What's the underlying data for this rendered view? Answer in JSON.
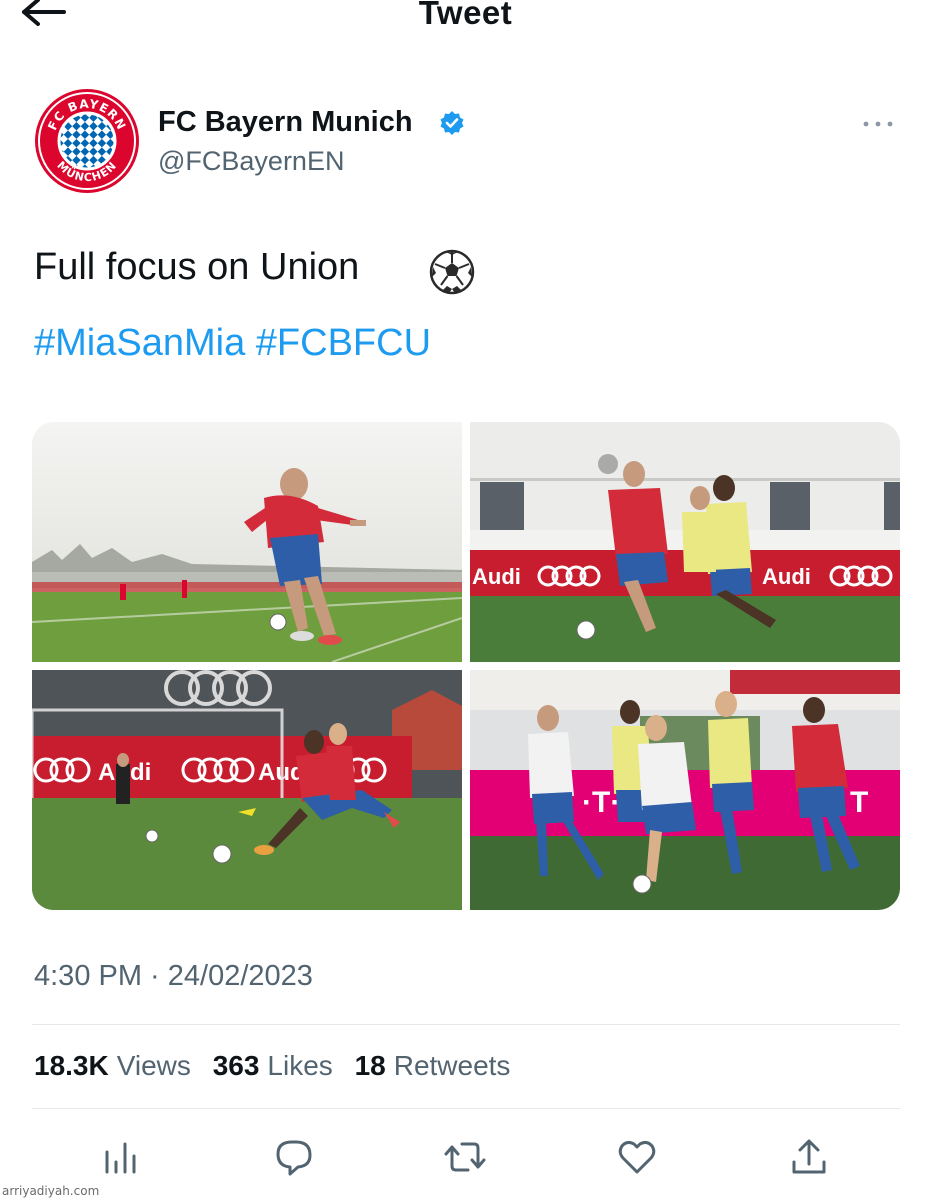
{
  "header": {
    "title": "Tweet",
    "back_icon": "arrow-left-icon"
  },
  "author": {
    "name": "FC Bayern Munich",
    "handle": "@FCBayernEN",
    "verified": true,
    "avatar_text_top": "FC BAYERN",
    "avatar_text_bottom": "MÜNCHEN",
    "colors": {
      "badge": "#1d9bf0",
      "brand_red": "#dc052d",
      "brand_blue": "#0066b2"
    }
  },
  "tweet": {
    "text": "Full focus on Union",
    "emoji": "soccer-ball-icon",
    "hashtags": [
      "#MiaSanMia",
      "#FCBFCU"
    ],
    "hashtag_color": "#1d9bf0"
  },
  "media": {
    "photo_count": 4,
    "board_text": "Audi"
  },
  "meta": {
    "timestamp": "4:30 PM · 24/02/2023"
  },
  "stats": {
    "views_count": "18.3K",
    "views_label": "Views",
    "likes_count": "363",
    "likes_label": "Likes",
    "retweets_count": "18",
    "retweets_label": "Retweets"
  },
  "actions": [
    "analytics-icon",
    "reply-icon",
    "retweet-icon",
    "like-icon",
    "share-icon"
  ],
  "watermark": "arriyadiyah.com"
}
